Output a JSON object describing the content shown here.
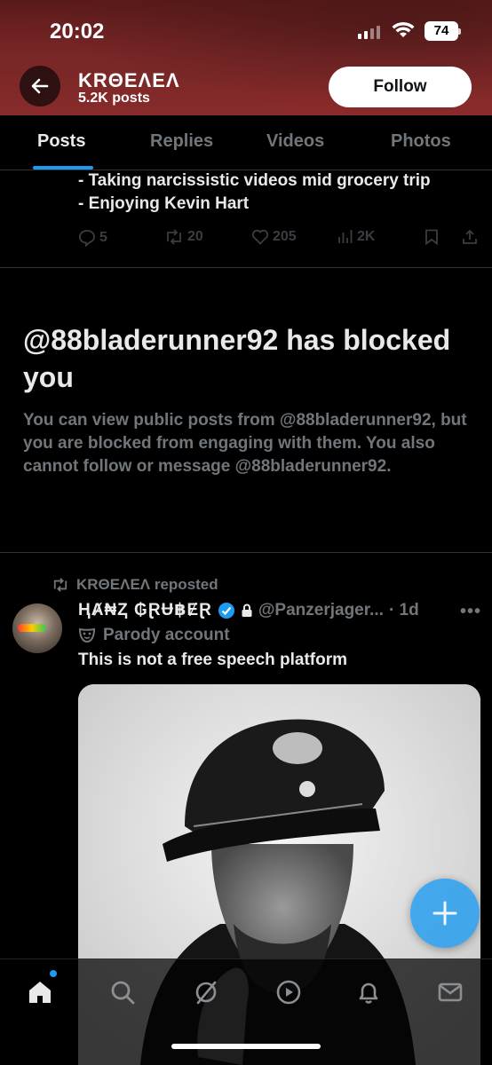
{
  "status_bar": {
    "time": "20:02",
    "battery": "74"
  },
  "header": {
    "profile_name": "KRΘEɅEɅ",
    "post_count": "5.2K posts",
    "follow_label": "Follow"
  },
  "tabs": [
    {
      "label": "Posts",
      "active": true
    },
    {
      "label": "Replies",
      "active": false
    },
    {
      "label": "Videos",
      "active": false
    },
    {
      "label": "Photos",
      "active": false
    }
  ],
  "previous_post": {
    "lines": [
      "- Taking narcissistic videos mid grocery trip",
      "- Enjoying Kevin Hart"
    ],
    "replies": "5",
    "reposts": "20",
    "likes": "205",
    "views": "2K"
  },
  "blocked_notice": {
    "title": "@88bladerunner92 has blocked you",
    "body": "You can view public posts from @88bladerunner92, but you are blocked from engaging with them. You also cannot follow or message @88bladerunner92."
  },
  "repost": {
    "reposted_by": "KRΘEɅEɅ reposted",
    "author": "ⱧȺ₦Ⱬ ₲ⱤɄ฿ɆⱤ",
    "handle": "@Panzerjager...",
    "time": "· 1d",
    "parody_label": "Parody account",
    "text": "This is not a free speech platform"
  },
  "colors": {
    "accent": "#1d9bf0",
    "muted": "#71767b",
    "header_bg": "#7a2626"
  }
}
